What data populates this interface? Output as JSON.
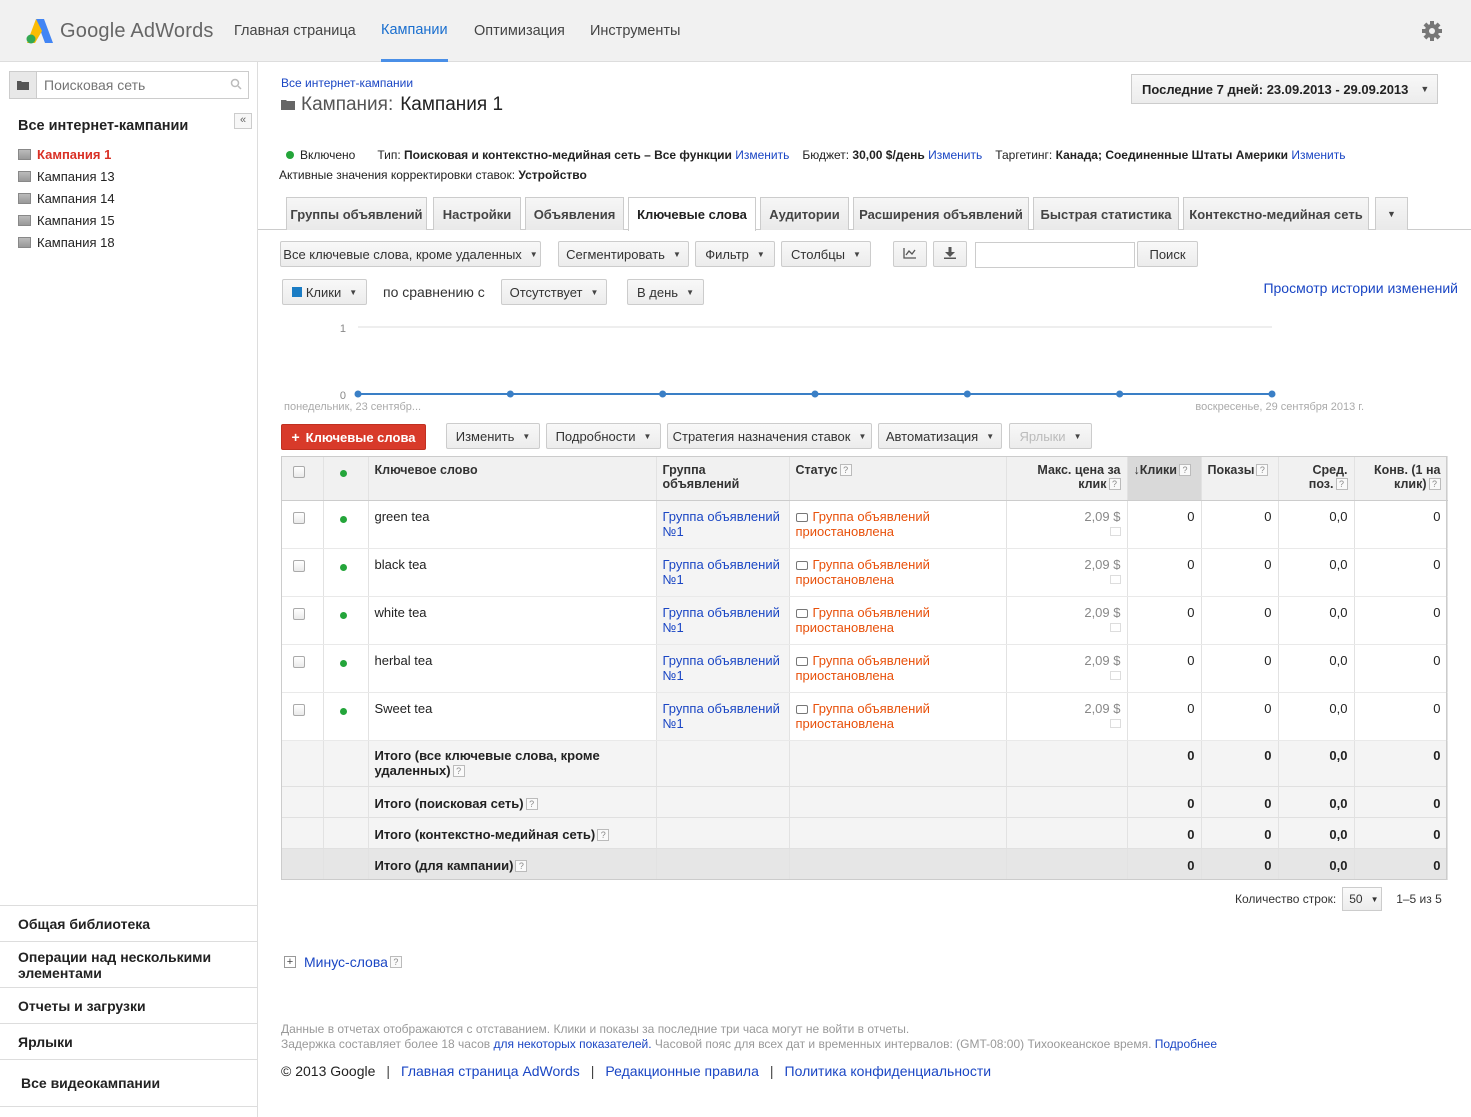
{
  "app": {
    "brand": "Google AdWords",
    "accent": "#1a6fcf"
  },
  "topnav": [
    {
      "label": "Главная страница",
      "active": false
    },
    {
      "label": "Кампании",
      "active": true
    },
    {
      "label": "Оптимизация",
      "active": false
    },
    {
      "label": "Инструменты",
      "active": false
    }
  ],
  "sidebar": {
    "search_placeholder": "Поисковая сеть",
    "title": "Все интернет-кампании",
    "collapse_label": "«",
    "campaigns": [
      {
        "label": "Кампания 1",
        "active": true
      },
      {
        "label": "Кампания 13",
        "active": false
      },
      {
        "label": "Кампания 14",
        "active": false
      },
      {
        "label": "Кампания 15",
        "active": false
      },
      {
        "label": "Кампания 18",
        "active": false
      }
    ],
    "bottom": [
      "Общая библиотека",
      "Операции над несколькими элементами",
      "Отчеты и загрузки",
      "Ярлыки",
      "Все видеокампании"
    ]
  },
  "header": {
    "breadcrumb": "Все интернет-кампании",
    "title_label": "Кампания:",
    "title_name": "Кампания 1",
    "date_range": "Последние 7 дней: 23.09.2013 - 29.09.2013"
  },
  "status": {
    "state": "Включено",
    "type_label": "Тип:",
    "type_value": "Поисковая и контекстно-медийная сеть – Все функции",
    "change": "Изменить",
    "budget_label": "Бюджет:",
    "budget_value": "30,00 $/день",
    "targeting_label": "Таргетинг:",
    "targeting_value": "Канада; Соединенные Штаты Америки",
    "bid_label": "Активные значения корректировки ставок:",
    "bid_value": "Устройство"
  },
  "tabs": [
    {
      "label": "Группы объявлений",
      "active": false
    },
    {
      "label": "Настройки",
      "active": false
    },
    {
      "label": "Объявления",
      "active": false
    },
    {
      "label": "Ключевые слова",
      "active": true
    },
    {
      "label": "Аудитории",
      "active": false
    },
    {
      "label": "Расширения объявлений",
      "active": false
    },
    {
      "label": "Быстрая статистика",
      "active": false
    },
    {
      "label": "Контекстно-медийная сеть",
      "active": false
    }
  ],
  "toolbar": {
    "filter_select": "Все ключевые слова, кроме удаленных",
    "segment": "Сегментировать",
    "filter": "Фильтр",
    "columns": "Столбцы",
    "search_button": "Поиск",
    "metric": "Клики",
    "compare_label": "по сравнению с",
    "compare_value": "Отсутствует",
    "period": "В день",
    "history_link": "Просмотр истории изменений"
  },
  "chart_data": {
    "type": "line",
    "x": [
      "2013-09-23",
      "2013-09-24",
      "2013-09-25",
      "2013-09-26",
      "2013-09-27",
      "2013-09-28",
      "2013-09-29"
    ],
    "series": [
      {
        "values": [
          0,
          0,
          0,
          0,
          0,
          0,
          0
        ]
      }
    ],
    "ylim": [
      0,
      1
    ],
    "y_ticks": [
      "0",
      "1"
    ],
    "x_start_label": "понедельник, 23 сентябр...",
    "x_end_label": "воскресенье, 29 сентября 2013 г.",
    "color": "#3a7fc6"
  },
  "actions": {
    "add": "Ключевые слова",
    "edit": "Изменить",
    "details": "Подробности",
    "bid_strategy": "Стратегия назначения ставок",
    "automate": "Автоматизация",
    "labels": "Ярлыки"
  },
  "table": {
    "headers": {
      "keyword": "Ключевое слово",
      "adgroup": "Группа объявлений",
      "status": "Статус",
      "max_cpc": "Макс. цена за клик",
      "clicks": "Клики",
      "impressions": "Показы",
      "avg_pos": "Сред. поз.",
      "conv": "Конв. (1 на клик)"
    },
    "rows": [
      {
        "keyword": "green tea",
        "adgroup": "Группа объявлений №1",
        "status": "Группа объявлений приостановлена",
        "max_cpc": "2,09 $",
        "clicks": "0",
        "impressions": "0",
        "avg_pos": "0,0",
        "conv": "0"
      },
      {
        "keyword": "black tea",
        "adgroup": "Группа объявлений №1",
        "status": "Группа объявлений приостановлена",
        "max_cpc": "2,09 $",
        "clicks": "0",
        "impressions": "0",
        "avg_pos": "0,0",
        "conv": "0"
      },
      {
        "keyword": "white tea",
        "adgroup": "Группа объявлений №1",
        "status": "Группа объявлений приостановлена",
        "max_cpc": "2,09 $",
        "clicks": "0",
        "impressions": "0",
        "avg_pos": "0,0",
        "conv": "0"
      },
      {
        "keyword": "herbal tea",
        "adgroup": "Группа объявлений №1",
        "status": "Группа объявлений приостановлена",
        "max_cpc": "2,09 $",
        "clicks": "0",
        "impressions": "0",
        "avg_pos": "0,0",
        "conv": "0"
      },
      {
        "keyword": "Sweet tea",
        "adgroup": "Группа объявлений №1",
        "status": "Группа объявлений приостановлена",
        "max_cpc": "2,09 $",
        "clicks": "0",
        "impressions": "0",
        "avg_pos": "0,0",
        "conv": "0"
      }
    ],
    "totals": [
      {
        "label": "Итого (все ключевые слова, кроме удаленных)",
        "clicks": "0",
        "impressions": "0",
        "avg_pos": "0,0",
        "conv": "0"
      },
      {
        "label": "Итого (поисковая сеть)",
        "clicks": "0",
        "impressions": "0",
        "avg_pos": "0,0",
        "conv": "0"
      },
      {
        "label": "Итого (контекстно-медийная сеть)",
        "clicks": "0",
        "impressions": "0",
        "avg_pos": "0,0",
        "conv": "0"
      },
      {
        "label": "Итого (для кампании)",
        "clicks": "0",
        "impressions": "0",
        "avg_pos": "0,0",
        "conv": "0"
      }
    ]
  },
  "pagination": {
    "rows_label": "Количество строк:",
    "rows_value": "50",
    "range": "1–5 из 5"
  },
  "negative_keywords": "Минус-слова",
  "notice": {
    "line1": "Данные в отчетах отображаются с отставанием. Клики и показы за последние три часа могут не войти в отчеты.",
    "line2_prefix": "Задержка составляет более 18 часов",
    "line2_link": "для некоторых показателей.",
    "line2_mid": "Часовой пояс для всех дат и временных интервалов: (GMT-08:00) Тихоокеанское время.",
    "line2_more": "Подробнее"
  },
  "footer": {
    "copyright": "© 2013 Google",
    "links": [
      "Главная страница AdWords",
      "Редакционные правила",
      "Политика конфиденциальности"
    ]
  }
}
